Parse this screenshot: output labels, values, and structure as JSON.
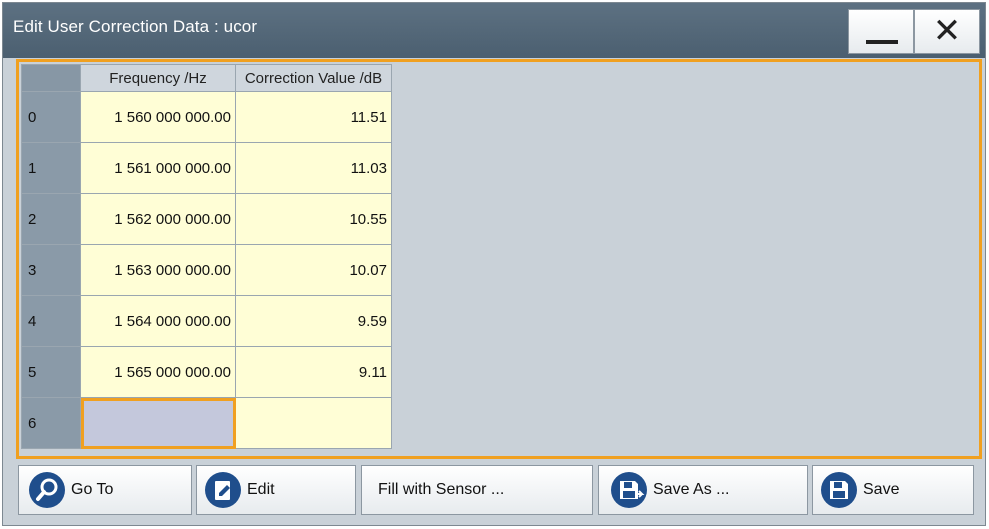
{
  "window": {
    "title": "Edit User Correction Data : ucor"
  },
  "table": {
    "headers": {
      "index": "",
      "frequency": "Frequency /Hz",
      "correction": "Correction Value /dB"
    },
    "rows": [
      {
        "index": "0",
        "frequency": "1 560 000 000.00",
        "correction": "11.51"
      },
      {
        "index": "1",
        "frequency": "1 561 000 000.00",
        "correction": "11.03"
      },
      {
        "index": "2",
        "frequency": "1 562 000 000.00",
        "correction": "10.55"
      },
      {
        "index": "3",
        "frequency": "1 563 000 000.00",
        "correction": "10.07"
      },
      {
        "index": "4",
        "frequency": "1 564 000 000.00",
        "correction": "9.59"
      },
      {
        "index": "5",
        "frequency": "1 565 000 000.00",
        "correction": "9.11"
      },
      {
        "index": "6",
        "frequency": "",
        "correction": ""
      }
    ]
  },
  "buttons": {
    "goto": {
      "label": "Go To",
      "icon": "search-icon"
    },
    "edit": {
      "label": "Edit",
      "icon": "edit-icon"
    },
    "fill": {
      "label": "Fill with Sensor ..."
    },
    "save_as": {
      "label": "Save As ...",
      "icon": "save-as-icon"
    },
    "save": {
      "label": "Save",
      "icon": "save-icon"
    }
  },
  "colors": {
    "accent": "#f0a020",
    "titlebar": "#52677a",
    "cell_bg": "#fffed6",
    "icon_blue": "#1f4e8c"
  }
}
